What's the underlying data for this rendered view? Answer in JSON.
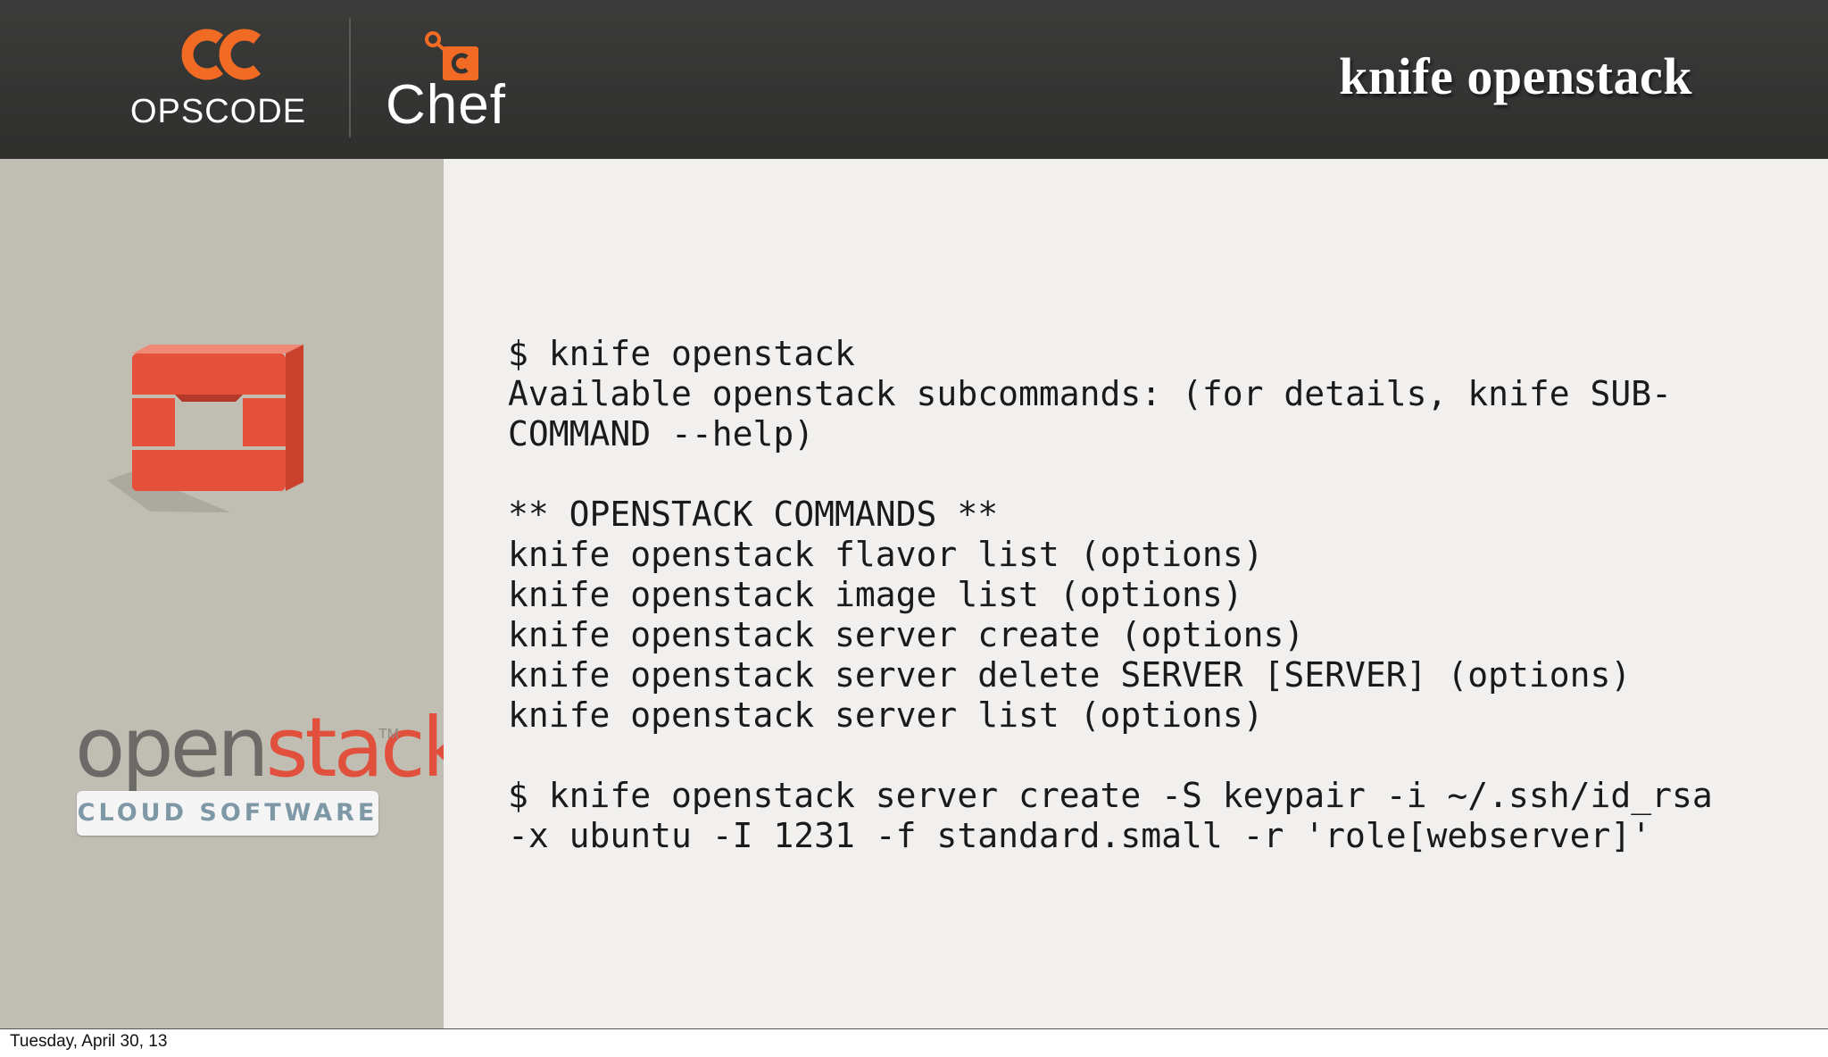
{
  "header": {
    "opscode_logo_text": "OPSCODE",
    "chef_logo_text": "Chef",
    "title": "knife openstack"
  },
  "sidebar": {
    "openstack_logo": {
      "word_open": "open",
      "word_stack": "stack",
      "tm": "TM",
      "tagline": "CLOUD SOFTWARE"
    }
  },
  "terminal": {
    "lines": [
      "$ knife openstack",
      "Available openstack subcommands: (for details, knife SUB-",
      "COMMAND --help)",
      "",
      "** OPENSTACK COMMANDS **",
      "knife openstack flavor list (options)",
      "knife openstack image list (options)",
      "knife openstack server create (options)",
      "knife openstack server delete SERVER [SERVER] (options)",
      "knife openstack server list (options)",
      "",
      "$ knife openstack server create -S keypair -i ~/.ssh/id_rsa",
      "-x ubuntu -I 1231 -f standard.small -r 'role[webserver]'"
    ]
  },
  "footer": {
    "date": "Tuesday, April 30, 13"
  },
  "colors": {
    "header_bg": "#333332",
    "brand_orange": "#f26b24",
    "openstack_red": "#e0503c",
    "sidebar_bg": "#c0beb3",
    "content_bg": "#f1f0ef"
  },
  "icons": {
    "opscode": "opscode-logo-icon",
    "chef": "chef-logo-icon",
    "openstack": "openstack-cube-icon"
  }
}
